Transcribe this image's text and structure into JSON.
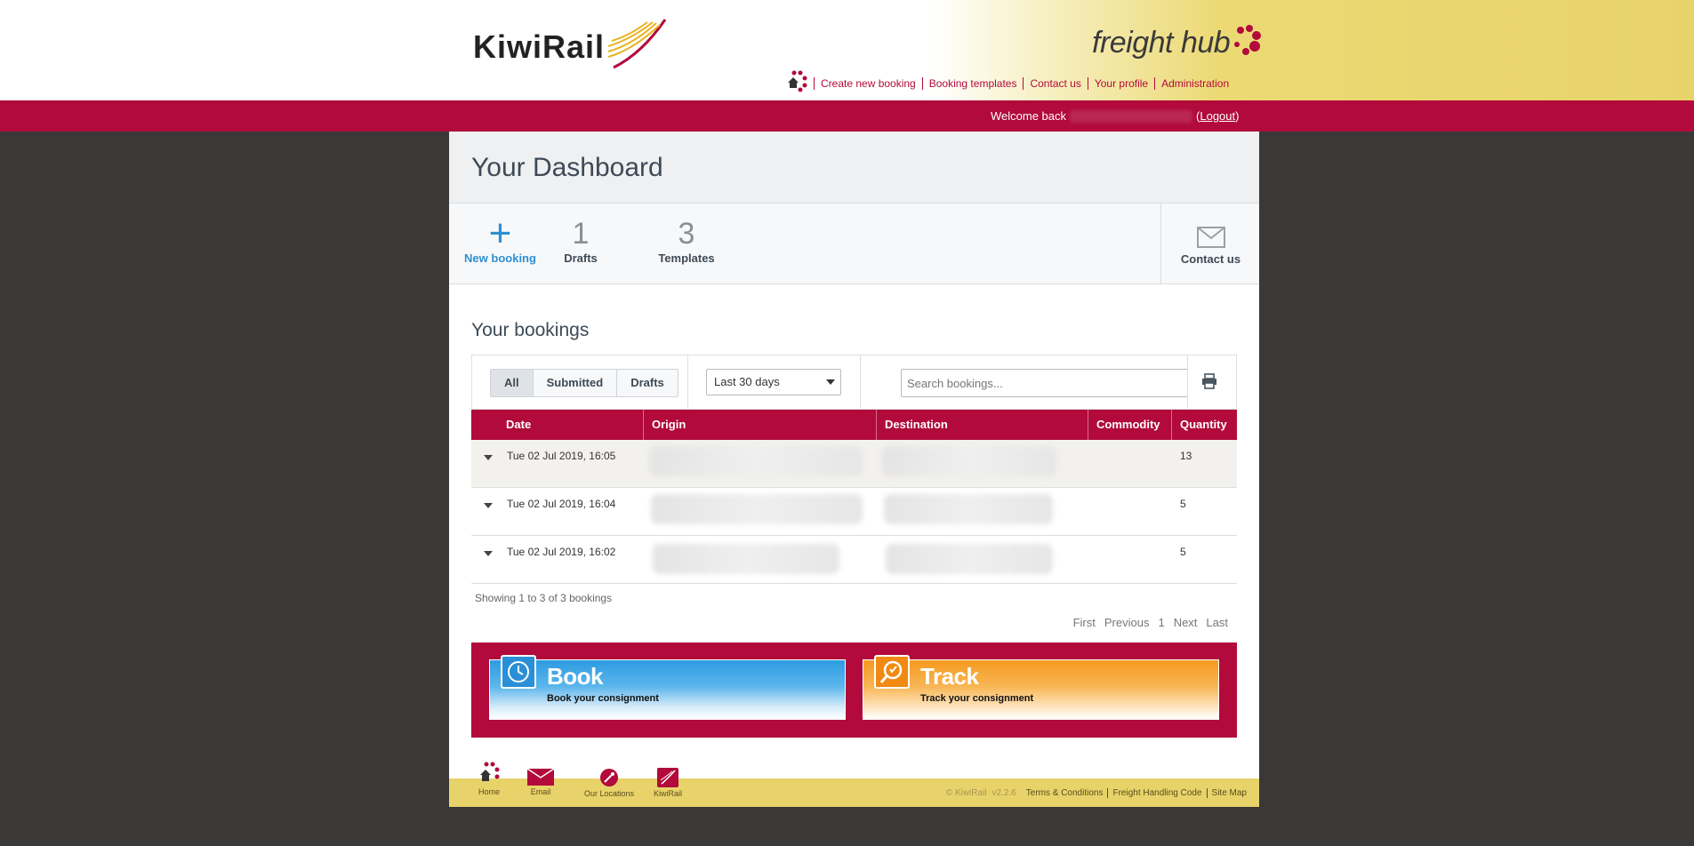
{
  "brand": {
    "name": "KiwiRail",
    "product": "freight hub"
  },
  "topnav": {
    "home_icon": "home-icon",
    "items": [
      "Create new booking",
      "Booking templates",
      "Contact us",
      "Your profile",
      "Administration"
    ]
  },
  "welcome": {
    "text": "Welcome back",
    "logout": "Logout"
  },
  "dashboard": {
    "title": "Your Dashboard",
    "new_booking": "New booking",
    "drafts_count": "1",
    "drafts_label": "Drafts",
    "templates_count": "3",
    "templates_label": "Templates",
    "contact_label": "Contact us"
  },
  "bookings": {
    "title": "Your bookings",
    "filters": [
      "All",
      "Submitted",
      "Drafts"
    ],
    "active_filter": "All",
    "period": "Last 30 days",
    "search_placeholder": "Search bookings...",
    "columns": [
      "Date",
      "Origin",
      "Destination",
      "Commodity",
      "Quantity"
    ],
    "rows": [
      {
        "date": "Tue 02 Jul 2019, 16:05",
        "quantity": "13"
      },
      {
        "date": "Tue 02 Jul 2019, 16:04",
        "quantity": "5"
      },
      {
        "date": "Tue 02 Jul 2019, 16:02",
        "quantity": "5"
      }
    ],
    "showing": "Showing 1 to 3 of 3 bookings",
    "pager": [
      "First",
      "Previous",
      "1",
      "Next",
      "Last"
    ]
  },
  "promo": {
    "book_title": "Book",
    "book_sub": "Book your consignment",
    "track_title": "Track",
    "track_sub": "Track your consignment"
  },
  "footer": {
    "icons": [
      "Home",
      "Email",
      "Our Locations",
      "KiwiRail"
    ],
    "copyright": "© KiwiRail",
    "version": "v2.2.6",
    "links": [
      "Terms & Conditions",
      "Freight Handling Code",
      "Site Map"
    ]
  },
  "colors": {
    "brand_red": "#b10a3b",
    "accent_blue": "#2e8fd1",
    "footer_yellow": "#e8d36a"
  }
}
